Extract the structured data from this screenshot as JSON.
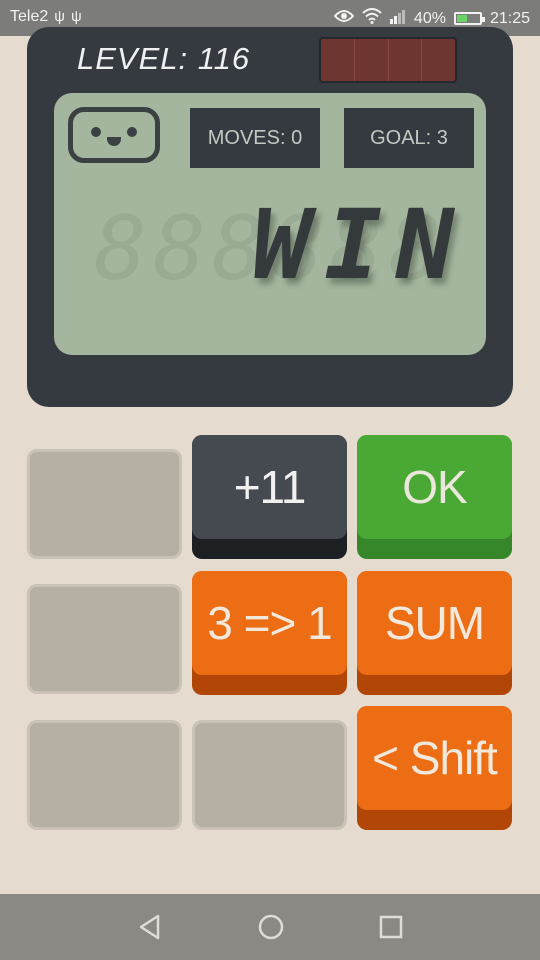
{
  "status_bar": {
    "carrier": "Tele2",
    "battery_percent": "40%",
    "time": "21:25",
    "icons": [
      "usb-icon",
      "usb-icon",
      "eye-icon",
      "wifi-icon",
      "signal-icon",
      "battery-charging-icon"
    ]
  },
  "game": {
    "level": "LEVEL: 116",
    "moves": "MOVES: 0",
    "goal": "GOAL: 3",
    "display_ghost": "888888",
    "display_text": "WIN"
  },
  "keys": [
    {
      "label": "",
      "style": "blank"
    },
    {
      "label": "+11",
      "style": "dark"
    },
    {
      "label": "OK",
      "style": "green"
    },
    {
      "label": "",
      "style": "blank"
    },
    {
      "label": "3 => 1",
      "style": "orange"
    },
    {
      "label": "SUM",
      "style": "orange"
    },
    {
      "label": "",
      "style": "blank"
    },
    {
      "label": "",
      "style": "blank"
    },
    {
      "label": "< Shift",
      "style": "orange"
    }
  ],
  "colors": {
    "background": "#e5dccf",
    "calculator": "#353a40",
    "screen": "#a4b69e",
    "orange": "#ec6d14",
    "green": "#49a934"
  },
  "nav": [
    "back-icon",
    "home-icon",
    "recents-icon"
  ]
}
